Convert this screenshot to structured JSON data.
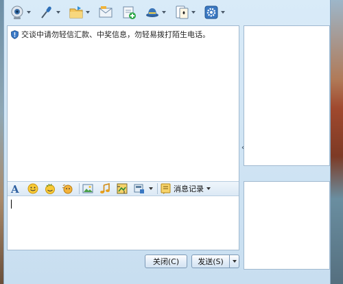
{
  "toolbar": {
    "items": [
      {
        "name": "webcam",
        "icon": "webcam-icon",
        "has_dropdown": true
      },
      {
        "name": "voice",
        "icon": "microphone-icon",
        "has_dropdown": true
      },
      {
        "name": "file-transfer",
        "icon": "folder-icon",
        "has_dropdown": true
      },
      {
        "name": "mail",
        "icon": "mail-icon",
        "has_dropdown": false
      },
      {
        "name": "doc-share",
        "icon": "document-add-icon",
        "has_dropdown": false
      },
      {
        "name": "remote-assist",
        "icon": "hat-icon",
        "has_dropdown": true
      },
      {
        "name": "game",
        "icon": "poker-card-icon",
        "has_dropdown": true
      },
      {
        "name": "app-settings",
        "icon": "app-gear-icon",
        "has_dropdown": true
      }
    ]
  },
  "chat": {
    "notice": "交谈中请勿轻信汇款、中奖信息，勿轻易拨打陌生电话。"
  },
  "format_bar": {
    "icons": [
      "font-icon",
      "smiley-icon",
      "wink-icon",
      "shake-icon",
      "image-icon",
      "music-icon",
      "screenshot-icon",
      "more-icon"
    ],
    "history_label": "消息记录"
  },
  "input": {
    "value": ""
  },
  "buttons": {
    "close_label": "关闭(C)",
    "send_label": "发送(S)"
  },
  "colors": {
    "window_bg": "#d9ebf8",
    "panel_border": "#9fb8cf",
    "button_border": "#7b98b5"
  }
}
